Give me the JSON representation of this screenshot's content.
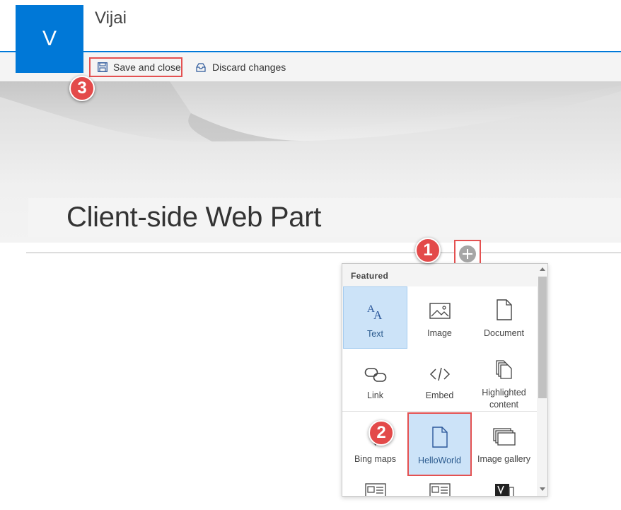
{
  "site": {
    "logo_letter": "V",
    "title": "Vijai"
  },
  "command_bar": {
    "save_label": "Save and close",
    "discard_label": "Discard changes"
  },
  "page": {
    "title": "Client-side Web Part"
  },
  "toolbox": {
    "section_label": "Featured",
    "tiles": [
      {
        "label": "Text",
        "icon": "text-icon",
        "selected": true
      },
      {
        "label": "Image",
        "icon": "image-icon"
      },
      {
        "label": "Document",
        "icon": "document-icon"
      },
      {
        "label": "Link",
        "icon": "link-icon"
      },
      {
        "label": "Embed",
        "icon": "embed-icon"
      },
      {
        "label": "Highlighted content",
        "icon": "highlighted-content-icon"
      },
      {
        "label": "Bing maps",
        "icon": "bing-maps-icon"
      },
      {
        "label": "HelloWorld",
        "icon": "document-icon",
        "selected": true
      },
      {
        "label": "Image gallery",
        "icon": "image-gallery-icon"
      }
    ]
  },
  "annotations": {
    "step1": "1",
    "step2": "2",
    "step3": "3"
  },
  "colors": {
    "accent": "#0078d7",
    "highlight": "#e45151",
    "selected_tile": "#cce3f8"
  }
}
